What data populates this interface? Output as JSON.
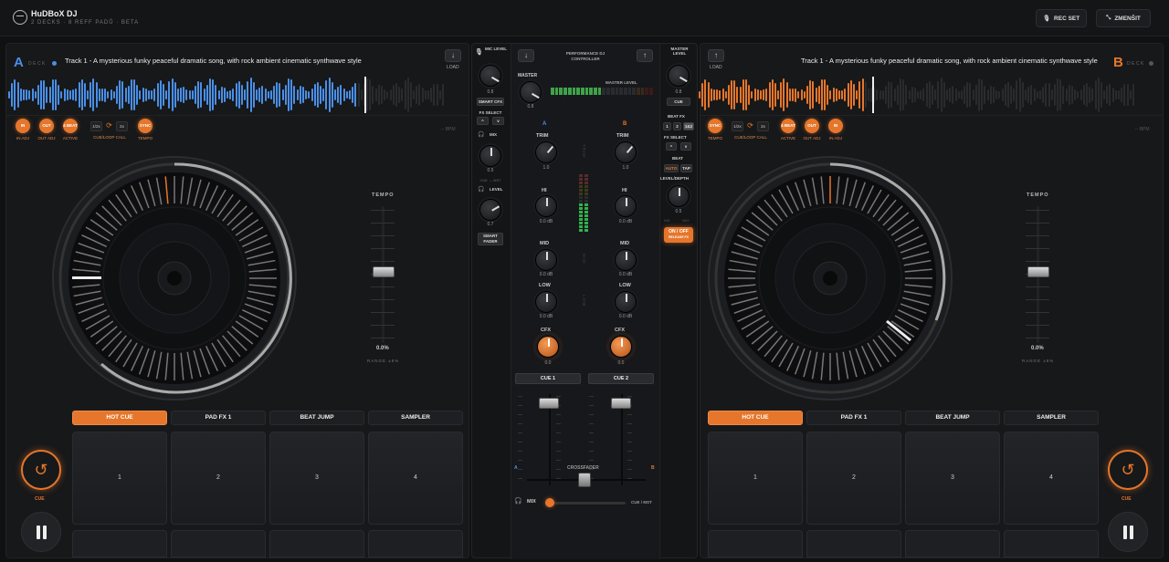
{
  "app": {
    "name": "HuDBoX DJ",
    "subtitle": "2 DECKS · 8 REFF PADŮ · BETA"
  },
  "top_buttons": {
    "rec": "REC SET",
    "shrink": "ZMENŠIT"
  },
  "deckA": {
    "letter": "A",
    "deck_label": "DECK",
    "track": "Track 1 - A mysterious funky peaceful dramatic song, with rock ambient cinematic synthwave style",
    "load": "LOAD",
    "load_icon": "↓",
    "buttons": {
      "in": "IN",
      "out": "OUT",
      "beat": "4 BEAT",
      "sync": "SYNC"
    },
    "labels": {
      "in": "IN ADJ",
      "out": "OUT ADJ",
      "active": "ACTIVE",
      "cueloop": "CUE/LOOP CALL",
      "tempo": "TEMPO"
    },
    "loop": {
      "half": "1/2x",
      "double": "2x"
    },
    "bpm": "-- BPM",
    "tempo_label": "TEMPO",
    "tempo_value": "0.0%",
    "range": "RANGE ±8%",
    "tabs": [
      "HOT CUE",
      "PAD FX 1",
      "BEAT JUMP",
      "SAMPLER"
    ],
    "pads": [
      "1",
      "2",
      "3",
      "4"
    ],
    "cue": "CUE"
  },
  "deckB": {
    "letter": "B",
    "deck_label": "DECK",
    "track": "Track 1 - A mysterious funky peaceful dramatic song, with rock ambient cinematic synthwave style",
    "load": "LOAD",
    "load_icon": "↑",
    "buttons": {
      "in": "IN",
      "out": "OUT",
      "beat": "4 BEAT",
      "sync": "SYNC"
    },
    "labels": {
      "in": "IN ADJ",
      "out": "OUT ADJ",
      "active": "ACTIVE",
      "cueloop": "CUE/LOOP CALL",
      "tempo": "TEMPO"
    },
    "loop": {
      "half": "1/2x",
      "double": "2x"
    },
    "bpm": "-- BPM",
    "tempo_label": "TEMPO",
    "tempo_value": "0.0%",
    "range": "RANGE ±8%",
    "tabs": [
      "HOT CUE",
      "PAD FX 1",
      "BEAT JUMP",
      "SAMPLER"
    ],
    "pads": [
      "1",
      "2",
      "3",
      "4"
    ],
    "cue": "CUE"
  },
  "mixer": {
    "mic_level": "MIC LEVEL",
    "mic_val": "0.8",
    "smart_cfx": "SMART CFX",
    "fx_select": "FX SELECT",
    "mix": "MIX",
    "mix_val": "0.5",
    "cue_mst": "CUE ↔ MST",
    "level": "LEVEL",
    "level_val": "0.7",
    "smart_fader": "SMART FADER",
    "title": "PERFORMANCE DJ CONTROLLER",
    "master": "MASTER",
    "master_val": "0.8",
    "master_level": "MASTER LEVEL",
    "master_level_top": "MASTER LEVEL",
    "master_level_val": "0.8",
    "cue_btn": "CUE",
    "beat_fx": "BEAT FX",
    "beat_fx_opts": [
      "1",
      "2",
      "1&2"
    ],
    "fx_select_right": "FX SELECT",
    "beat": "BEAT",
    "auto": "AUTO",
    "tap": "TAP",
    "level_depth": "LEVEL/DEPTH",
    "level_depth_val": "0.5",
    "min": "MIN",
    "max": "MAX",
    "on_off": "ON / OFF",
    "release_fx": "RELEASE FX",
    "ch_a": "A",
    "ch_b": "B",
    "trim": "TRIM",
    "trim_a": "1.0",
    "trim_b": "1.0",
    "hi": "HI",
    "hi_a": "0.0 dB",
    "hi_b": "0.0 dB",
    "mid": "MID",
    "mid_a": "0.0 dB",
    "mid_b": "0.0 dB",
    "low": "LOW",
    "low_a": "0.0 dB",
    "low_b": "0.0 dB",
    "cfx": "CFX",
    "cfx_a": "0.0",
    "cfx_b": "0.0",
    "cue1": "CUE 1",
    "cue2": "CUE 2",
    "crossfader": "CROSSFADER",
    "xa": "A",
    "xb": "B",
    "phones_mix": "MIX",
    "phones_right": "CUE / MST",
    "vl_trim": "TRIM",
    "vl_mid": "MID",
    "vl_low": "LOW"
  },
  "colors": {
    "deckA": "#4a8fe6",
    "deckB": "#e5762b",
    "accent": "#e5762b"
  }
}
